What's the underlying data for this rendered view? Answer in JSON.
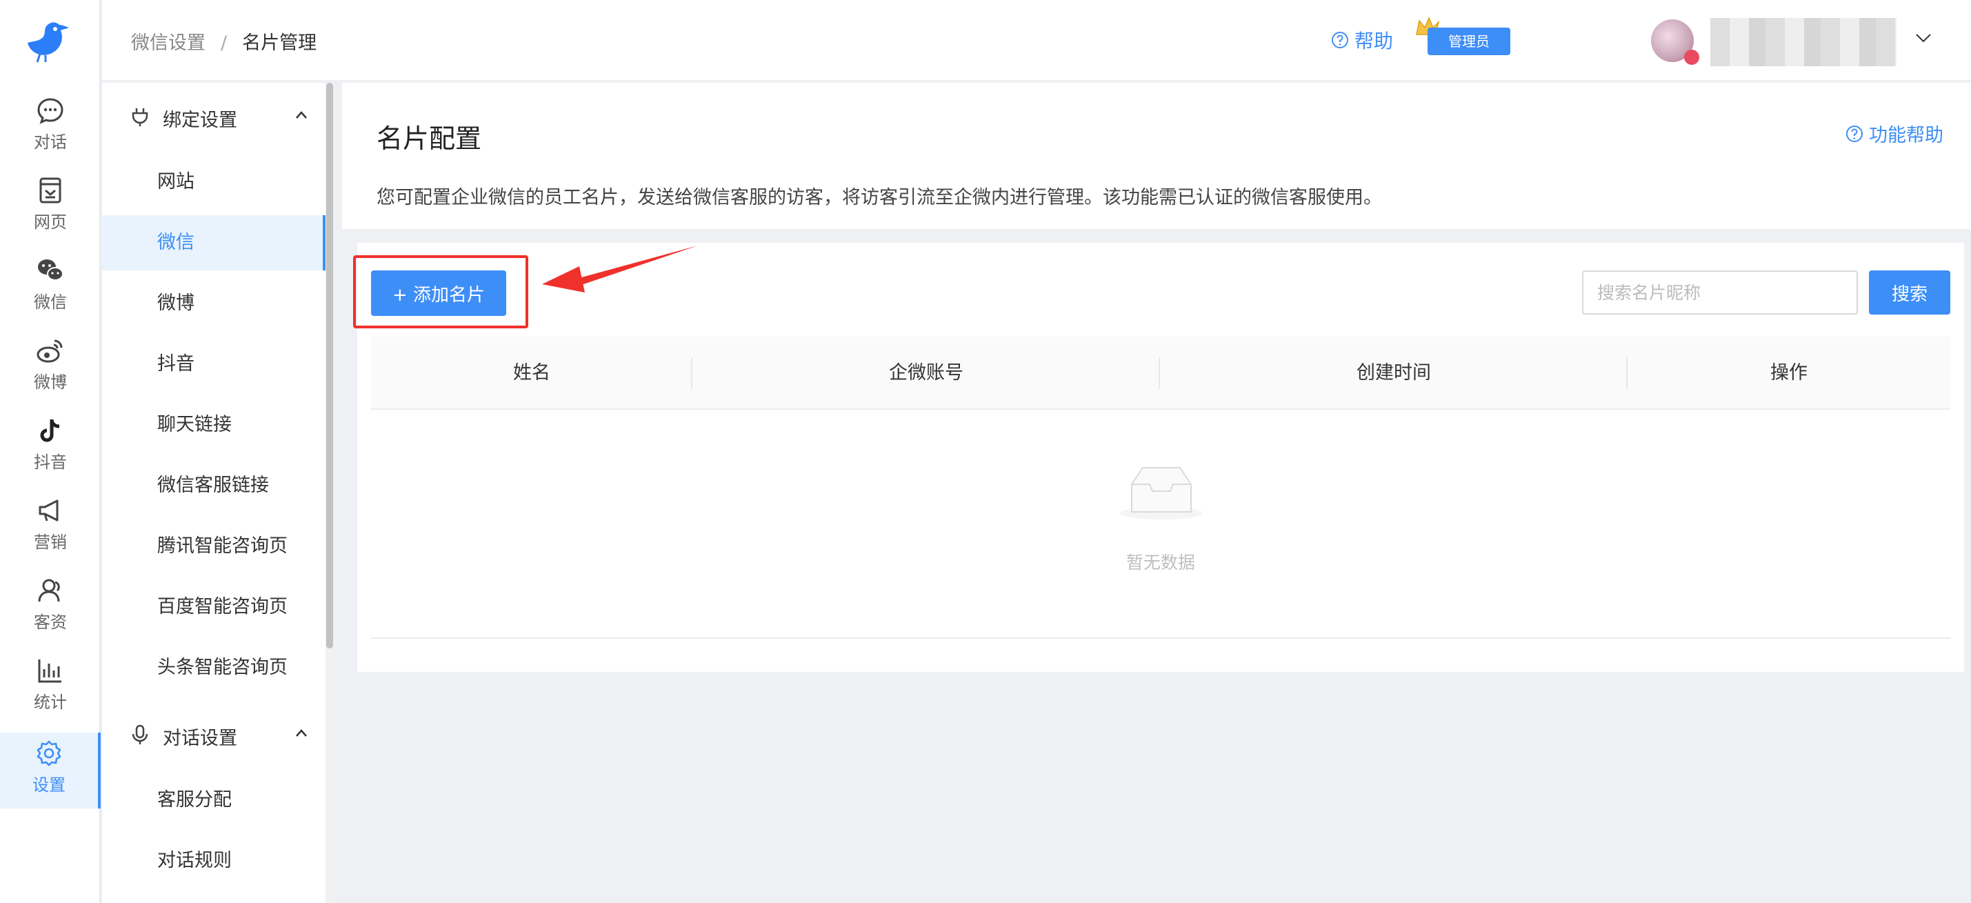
{
  "brand": {
    "accent": "#3e8ef7",
    "highlight": "#f0302b",
    "logo_icon": "bird-logo-icon"
  },
  "rail": {
    "items": [
      {
        "label": "对话",
        "icon": "chat-icon"
      },
      {
        "label": "网页",
        "icon": "webpage-icon"
      },
      {
        "label": "微信",
        "icon": "wechat-icon"
      },
      {
        "label": "微博",
        "icon": "weibo-icon"
      },
      {
        "label": "抖音",
        "icon": "douyin-icon"
      },
      {
        "label": "营销",
        "icon": "megaphone-icon"
      },
      {
        "label": "客资",
        "icon": "customer-icon"
      },
      {
        "label": "统计",
        "icon": "stats-icon"
      },
      {
        "label": "设置",
        "icon": "gear-icon",
        "active": true
      }
    ]
  },
  "header": {
    "breadcrumb": [
      "微信设置",
      "名片管理"
    ],
    "breadcrumb_sep": "/",
    "help": "帮助",
    "role_badge": "管理员"
  },
  "submenu": {
    "groups": [
      {
        "title": "绑定设置",
        "icon": "plug-icon",
        "items": [
          "网站",
          "微信",
          "微博",
          "抖音",
          "聊天链接",
          "微信客服链接",
          "腾讯智能咨询页",
          "百度智能咨询页",
          "头条智能咨询页"
        ],
        "active": "微信"
      },
      {
        "title": "对话设置",
        "icon": "microphone-icon",
        "items": [
          "客服分配",
          "对话规则"
        ]
      }
    ]
  },
  "main": {
    "title": "名片配置",
    "func_help": "功能帮助",
    "description": "您可配置企业微信的员工名片，发送给微信客服的访客，将访客引流至企微内进行管理。该功能需已认证的微信客服使用。",
    "add_button": "+ 添加名片",
    "search_placeholder": "搜索名片昵称",
    "search_button": "搜索",
    "table": {
      "columns": [
        "姓名",
        "企微账号",
        "创建时间",
        "操作"
      ],
      "rows": [],
      "empty_text": "暂无数据"
    }
  }
}
